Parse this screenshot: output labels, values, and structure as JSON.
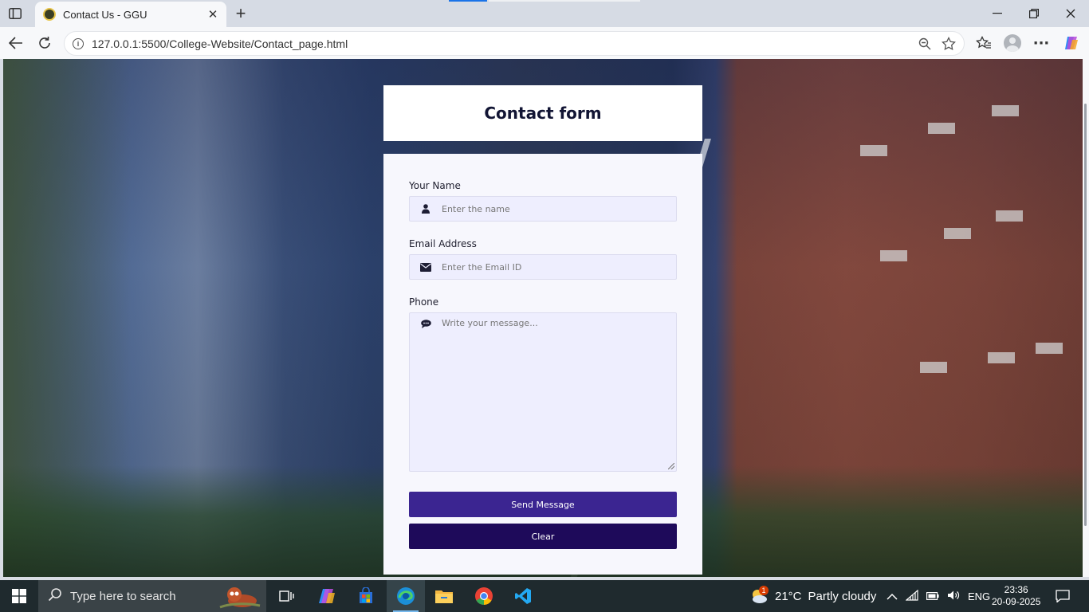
{
  "browser": {
    "tab_title": "Contact Us - GGU",
    "url": "127.0.0.1:5500/College-Website/Contact_page.html",
    "icons": [
      "sidebar-toggle-icon",
      "close-icon",
      "plus-icon",
      "back-icon",
      "reload-icon",
      "info-icon",
      "zoom-out-icon",
      "star-icon",
      "favorites-icon",
      "profile-icon",
      "more-icon",
      "copilot-icon",
      "minimize-icon",
      "maximize-icon",
      "window-close-icon"
    ]
  },
  "page": {
    "title": "Contact form",
    "form": {
      "name_label": "Your Name",
      "name_placeholder": "Enter the name",
      "email_label": "Email Address",
      "email_placeholder": "Enter the Email ID",
      "phone_label": "Phone",
      "message_placeholder": "Write your message...",
      "send_label": "Send Message",
      "clear_label": "Clear"
    },
    "colors": {
      "send_button": "#3b2591",
      "clear_button": "#1e0a5a",
      "input_bg": "#eeeefe"
    }
  },
  "taskbar": {
    "search_placeholder": "Type here to search",
    "weather_temp": "21°C",
    "weather_text": "Partly cloudy",
    "weather_badge": "1",
    "language": "ENG",
    "time": "23:36",
    "date": "20-09-2025"
  }
}
